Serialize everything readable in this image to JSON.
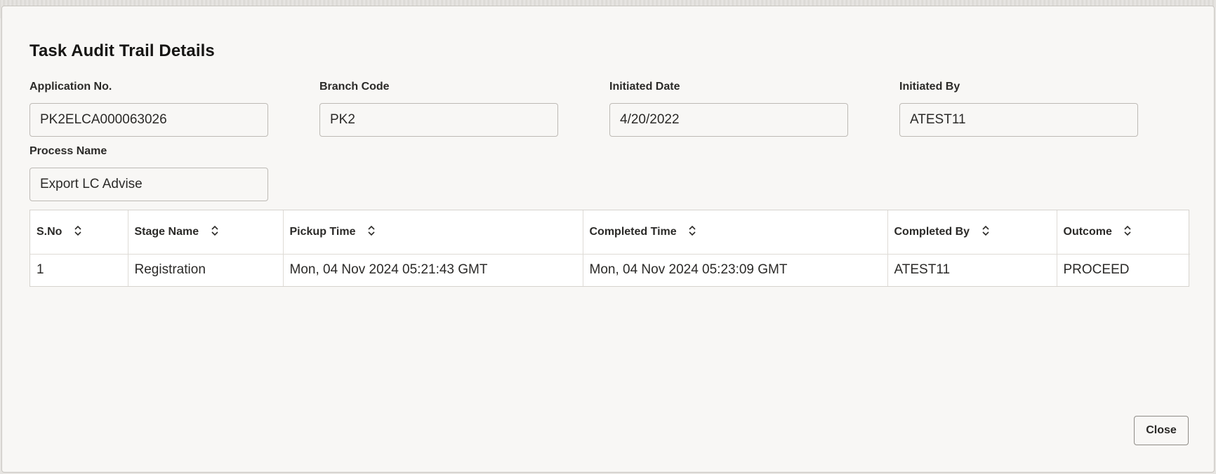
{
  "dialog": {
    "title": "Task Audit Trail Details",
    "close_label": "Close"
  },
  "fields": {
    "application_no": {
      "label": "Application No.",
      "value": "PK2ELCA000063026"
    },
    "branch_code": {
      "label": "Branch Code",
      "value": "PK2"
    },
    "initiated_date": {
      "label": "Initiated Date",
      "value": "4/20/2022"
    },
    "initiated_by": {
      "label": "Initiated By",
      "value": "ATEST11"
    },
    "process_name": {
      "label": "Process Name",
      "value": "Export LC Advise"
    }
  },
  "table": {
    "columns": [
      "S.No",
      "Stage Name",
      "Pickup Time",
      "Completed Time",
      "Completed By",
      "Outcome"
    ],
    "rows": [
      [
        "1",
        "Registration",
        "Mon, 04 Nov 2024 05:21:43 GMT",
        "Mon, 04 Nov 2024 05:23:09 GMT",
        "ATEST11",
        "PROCEED"
      ]
    ]
  },
  "icons": {
    "sort": "sort-up-down-icon"
  }
}
